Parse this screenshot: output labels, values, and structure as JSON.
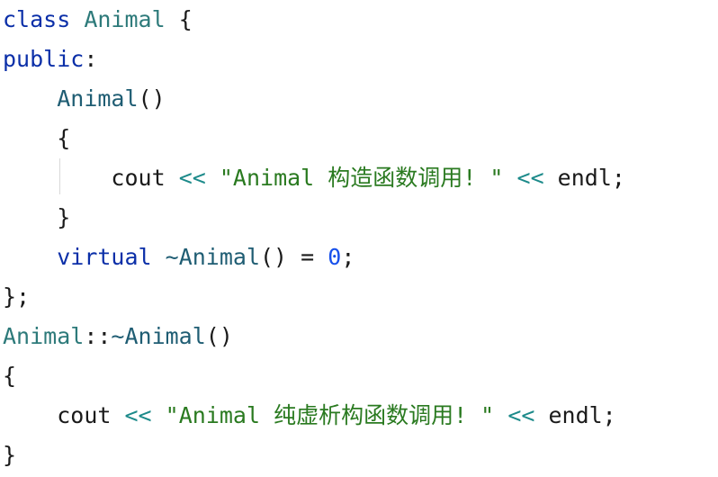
{
  "code": {
    "lines": [
      {
        "indent": "",
        "tokens": [
          {
            "t": "class",
            "c": "kw"
          },
          {
            "t": " ",
            "c": "txt"
          },
          {
            "t": "Animal",
            "c": "cls"
          },
          {
            "t": " {",
            "c": "txt"
          }
        ]
      },
      {
        "indent": "",
        "tokens": [
          {
            "t": "public",
            "c": "kw"
          },
          {
            "t": ":",
            "c": "txt"
          }
        ]
      },
      {
        "indent": "    ",
        "tokens": [
          {
            "t": "Animal",
            "c": "fn"
          },
          {
            "t": "()",
            "c": "txt"
          }
        ]
      },
      {
        "indent": "    ",
        "tokens": [
          {
            "t": "{",
            "c": "txt"
          }
        ]
      },
      {
        "indent": "        ",
        "tokens": [
          {
            "t": "cout",
            "c": "txt"
          },
          {
            "t": " ",
            "c": "txt"
          },
          {
            "t": "<<",
            "c": "op"
          },
          {
            "t": " ",
            "c": "txt"
          },
          {
            "t": "\"Animal 构造函数调用! \"",
            "c": "str"
          },
          {
            "t": " ",
            "c": "txt"
          },
          {
            "t": "<<",
            "c": "op"
          },
          {
            "t": " endl;",
            "c": "txt"
          }
        ]
      },
      {
        "indent": "    ",
        "tokens": [
          {
            "t": "}",
            "c": "txt"
          }
        ]
      },
      {
        "indent": "    ",
        "tokens": [
          {
            "t": "virtual",
            "c": "kw"
          },
          {
            "t": " ",
            "c": "txt"
          },
          {
            "t": "~Animal",
            "c": "fn"
          },
          {
            "t": "() = ",
            "c": "txt"
          },
          {
            "t": "0",
            "c": "num"
          },
          {
            "t": ";",
            "c": "txt"
          }
        ]
      },
      {
        "indent": "",
        "tokens": [
          {
            "t": "};",
            "c": "txt"
          }
        ]
      },
      {
        "indent": "",
        "tokens": [
          {
            "t": "Animal",
            "c": "cls"
          },
          {
            "t": "::",
            "c": "txt"
          },
          {
            "t": "~Animal",
            "c": "fn"
          },
          {
            "t": "()",
            "c": "txt"
          }
        ]
      },
      {
        "indent": "",
        "tokens": [
          {
            "t": "{",
            "c": "txt"
          }
        ]
      },
      {
        "indent": "    ",
        "tokens": [
          {
            "t": "cout",
            "c": "txt"
          },
          {
            "t": " ",
            "c": "txt"
          },
          {
            "t": "<<",
            "c": "op"
          },
          {
            "t": " ",
            "c": "txt"
          },
          {
            "t": "\"Animal 纯虚析构函数调用! \"",
            "c": "str"
          },
          {
            "t": " ",
            "c": "txt"
          },
          {
            "t": "<<",
            "c": "op"
          },
          {
            "t": " endl;",
            "c": "txt"
          }
        ]
      },
      {
        "indent": "",
        "tokens": [
          {
            "t": "}",
            "c": "txt"
          }
        ]
      }
    ]
  }
}
